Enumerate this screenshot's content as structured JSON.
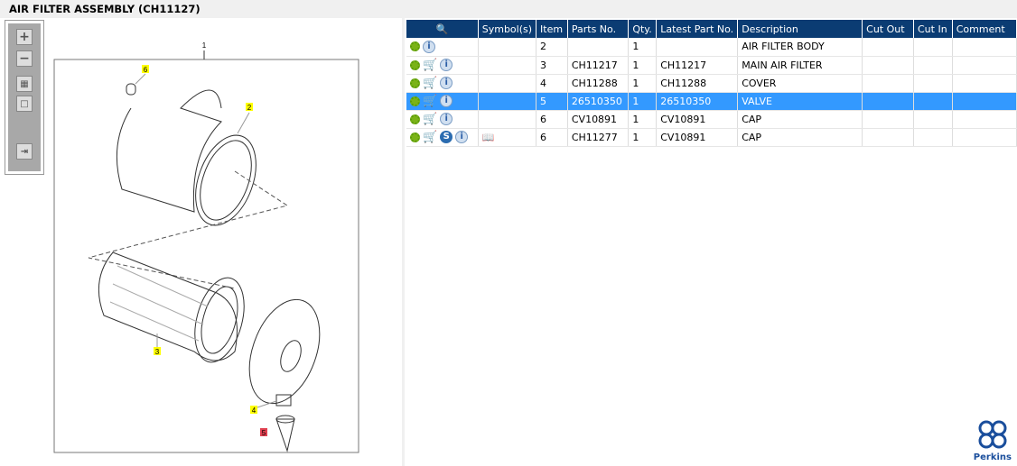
{
  "title": "AIR FILTER ASSEMBLY (CH11127)",
  "toolbar": {
    "zoom_in": "+",
    "zoom_out": "−"
  },
  "callouts": {
    "c1": "1",
    "c2": "2",
    "c3": "3",
    "c4": "4",
    "c5": "5",
    "c6": "6"
  },
  "table": {
    "headers": {
      "symbols": "Symbol(s)",
      "item": "Item",
      "parts": "Parts No.",
      "qty": "Qty.",
      "latest": "Latest Part No.",
      "desc": "Description",
      "cutout": "Cut Out",
      "cutin": "Cut In",
      "comment": "Comment"
    },
    "rows": [
      {
        "item": "2",
        "parts": "",
        "qty": "1",
        "latest": "",
        "desc": "AIR FILTER BODY"
      },
      {
        "item": "3",
        "parts": "CH11217",
        "qty": "1",
        "latest": "CH11217",
        "desc": "MAIN AIR FILTER"
      },
      {
        "item": "4",
        "parts": "CH11288",
        "qty": "1",
        "latest": "CH11288",
        "desc": "COVER"
      },
      {
        "item": "5",
        "parts": "26510350",
        "qty": "1",
        "latest": "26510350",
        "desc": "VALVE"
      },
      {
        "item": "6",
        "parts": "CV10891",
        "qty": "1",
        "latest": "CV10891",
        "desc": "CAP"
      },
      {
        "item": "6",
        "parts": "CH11277",
        "qty": "1",
        "latest": "CV10891",
        "desc": "CAP"
      }
    ]
  },
  "icons": {
    "s": "S",
    "i": "i",
    "cart": "🛒"
  },
  "brand": "Perkins",
  "colors": {
    "header": "#0b3c73",
    "selected": "#3399ff",
    "callout": "#ffff00",
    "callout_active": "#e04050"
  }
}
